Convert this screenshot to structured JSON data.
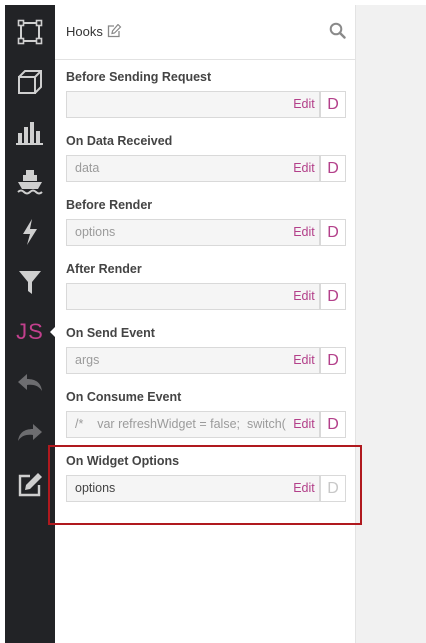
{
  "sidebar": {
    "items": [
      {
        "name": "select-icon"
      },
      {
        "name": "cube-icon"
      },
      {
        "name": "bar-chart-icon"
      },
      {
        "name": "ship-icon"
      },
      {
        "name": "lightning-icon"
      },
      {
        "name": "filter-icon"
      },
      {
        "name": "js-icon",
        "label": "JS"
      },
      {
        "name": "undo-icon"
      },
      {
        "name": "redo-icon"
      },
      {
        "name": "edit-icon"
      }
    ],
    "active_label": "JS"
  },
  "panel": {
    "title": "Hooks",
    "hooks": [
      {
        "label": "Before Sending Request",
        "value": "",
        "edit": "Edit",
        "d": "D",
        "enabled": true
      },
      {
        "label": "On Data Received",
        "value": "data",
        "edit": "Edit",
        "d": "D",
        "enabled": true
      },
      {
        "label": "Before Render",
        "value": "options",
        "edit": "Edit",
        "d": "D",
        "enabled": true
      },
      {
        "label": "After Render",
        "value": "",
        "edit": "Edit",
        "d": "D",
        "enabled": true
      },
      {
        "label": "On Send Event",
        "value": "args",
        "edit": "Edit",
        "d": "D",
        "enabled": true
      },
      {
        "label": "On Consume Event",
        "value": "/*    var refreshWidget = false;  switch(",
        "edit": "Edit",
        "d": "D",
        "enabled": true
      },
      {
        "label": "On Widget Options",
        "value": "options",
        "edit": "Edit",
        "d": "D",
        "enabled": false
      }
    ]
  },
  "colors": {
    "rail": "#222326",
    "accent": "#b3408a",
    "highlight": "#b0191e"
  }
}
